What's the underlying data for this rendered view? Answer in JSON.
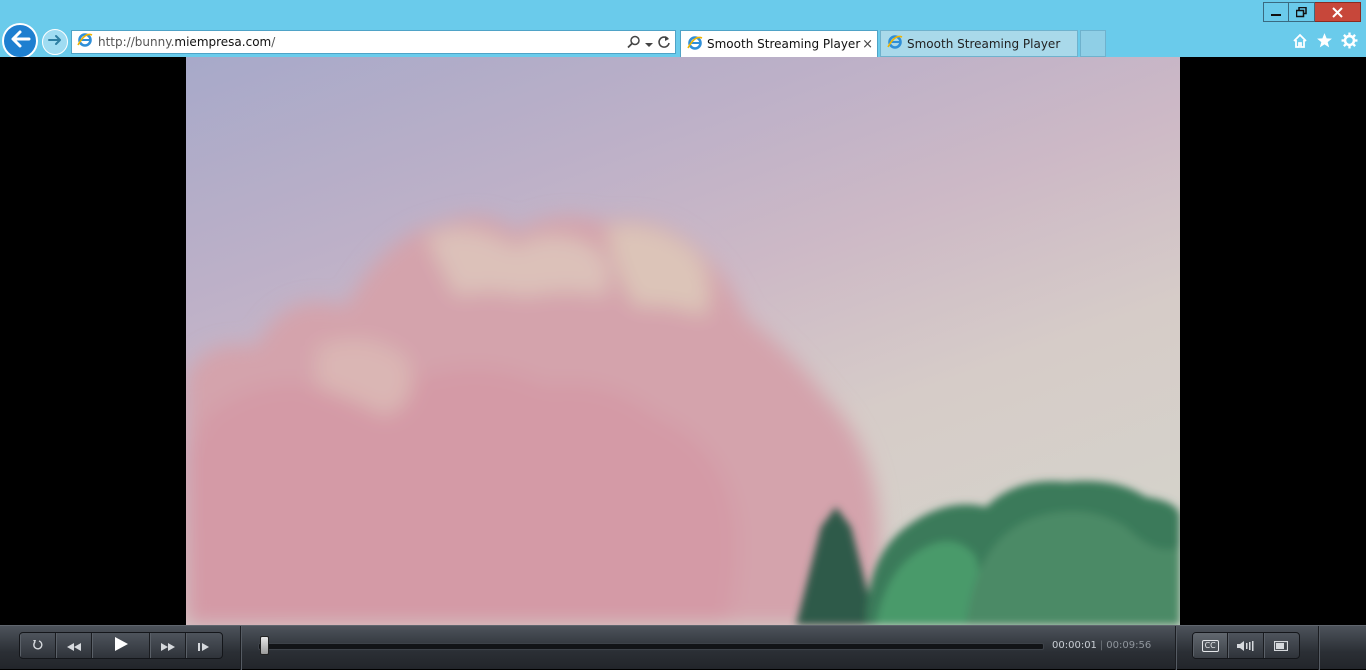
{
  "browser": {
    "address_scheme": "http://bunny.",
    "address_domain": "miempresa.com",
    "address_path": "/",
    "tabs": [
      {
        "label": "Smooth Streaming Player",
        "active": true
      },
      {
        "label": "Smooth Streaming Player",
        "active": false
      }
    ],
    "tab_close_glyph": "×",
    "accent_color": "#6acbeb"
  },
  "window_controls": [
    "minimize-icon",
    "restore-icon",
    "close-icon"
  ],
  "toolbar_icons": [
    "home-icon",
    "star-icon",
    "gear-icon"
  ],
  "player": {
    "buttons_left": [
      "replay-icon",
      "rewind-icon",
      "play-icon",
      "fast-forward-icon",
      "step-forward-icon"
    ],
    "buttons_right": [
      "closed-captions-icon",
      "volume-icon",
      "fullscreen-icon"
    ],
    "cc_label": "CC",
    "current_time": "00:00:01",
    "time_separator": "|",
    "duration": "00:09:56",
    "progress_fraction": 0.002
  }
}
